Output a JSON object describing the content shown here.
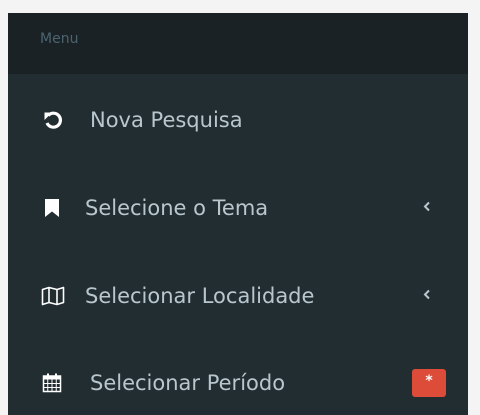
{
  "sidebar": {
    "header": "Menu",
    "items": [
      {
        "label": "Nova Pesquisa",
        "icon": "refresh-icon"
      },
      {
        "label": "Selecione o Tema",
        "icon": "bookmark-icon",
        "expandable": true
      },
      {
        "label": "Selecionar Localidade",
        "icon": "map-icon",
        "expandable": true
      },
      {
        "label": "Selecionar Período",
        "icon": "calendar-icon",
        "badge": "*"
      }
    ]
  },
  "colors": {
    "sidebar_bg": "#222d32",
    "header_bg": "#1a2226",
    "text": "#b8c7ce",
    "header_text": "#4b646f",
    "badge_bg": "#dd4b39"
  }
}
